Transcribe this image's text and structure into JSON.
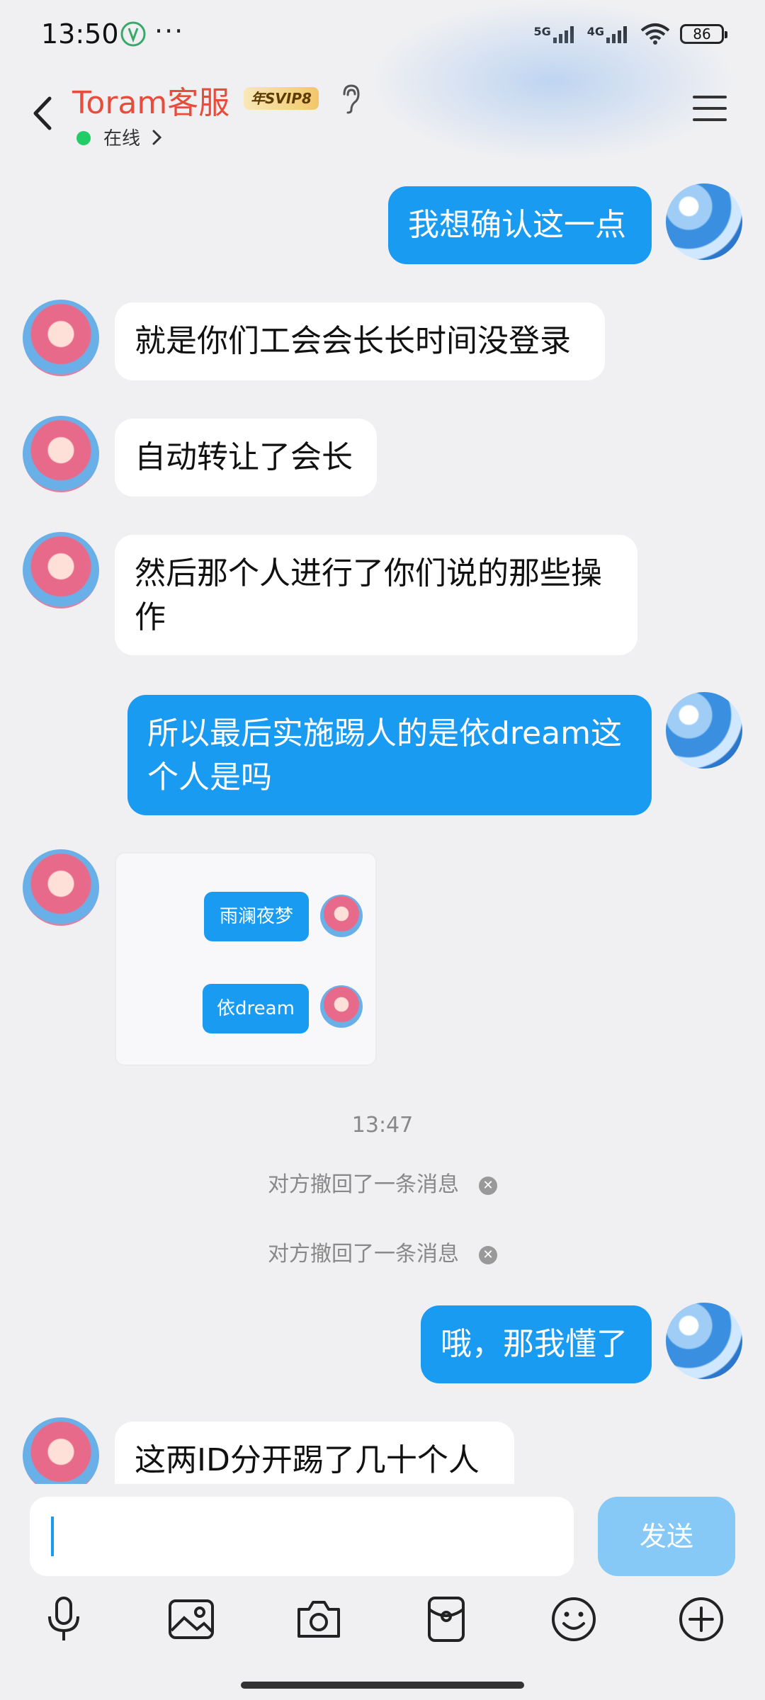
{
  "status_bar": {
    "time": "13:50",
    "more": "···",
    "signal_1": "5G",
    "signal_2": "4G",
    "battery": "86"
  },
  "header": {
    "title": "Toram客服",
    "badge": "年SVIP8",
    "status": "在线"
  },
  "messages": [
    {
      "side": "self",
      "text": "我想确认这一点"
    },
    {
      "side": "other",
      "text": "就是你们工会会长长时间没登录"
    },
    {
      "side": "other",
      "text": "自动转让了会长"
    },
    {
      "side": "other",
      "text": "然后那个人进行了你们说的那些操作"
    },
    {
      "side": "self",
      "text": "所以最后实施踢人的是依dream这个人是吗"
    },
    {
      "side": "other",
      "type": "image",
      "image_bubbles": [
        "雨澜夜梦",
        "依dream"
      ]
    },
    {
      "side": "self",
      "text": "哦，那我懂了"
    },
    {
      "side": "other",
      "text": "这两ID分开踢了几十个人"
    }
  ],
  "system": {
    "timestamp": "13:47",
    "recall_1": "对方撤回了一条消息",
    "recall_2": "对方撤回了一条消息"
  },
  "input": {
    "value": "",
    "send_label": "发送"
  },
  "toolbar": {
    "icons": [
      "microphone-icon",
      "image-icon",
      "camera-icon",
      "red-packet-icon",
      "emoji-icon",
      "plus-icon"
    ]
  },
  "colors": {
    "accent": "#1a9bf2",
    "title": "#e84c3d",
    "online": "#22cc66",
    "send_disabled": "#86c8f6"
  }
}
